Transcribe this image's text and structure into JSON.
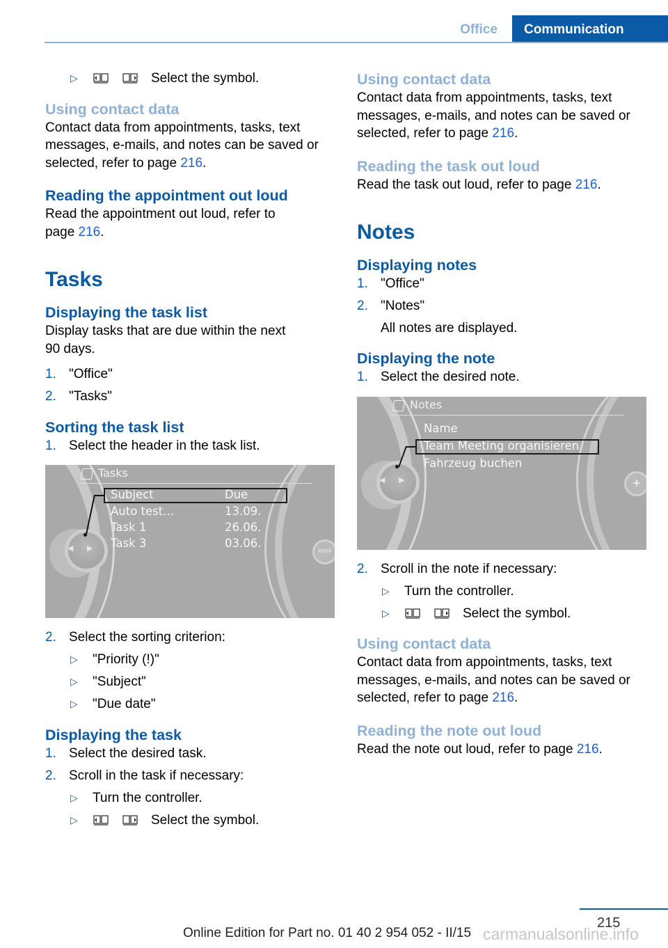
{
  "header": {
    "section_tab": "Office",
    "chapter_tab": "Communication"
  },
  "left": {
    "top_bullet": "Select the symbol.",
    "using_contact": {
      "heading": "Using contact data",
      "text": "Contact data from appointments, tasks, text messages, e-mails, and notes can be saved or selected, refer to page ",
      "page_ref": "216",
      "end": "."
    },
    "reading_appointment": {
      "heading": "Reading the appointment out loud",
      "text": "Read the appointment out loud, refer to page ",
      "page_ref": "216",
      "end": "."
    },
    "tasks_title": "Tasks",
    "displaying_task_list": {
      "heading": "Displaying the task list",
      "text": "Display tasks that are due within the next 90 days.",
      "steps": [
        {
          "num": "1.",
          "text": "\"Office\""
        },
        {
          "num": "2.",
          "text": "\"Tasks\""
        }
      ]
    },
    "sorting": {
      "heading": "Sorting the task list",
      "step1": {
        "num": "1.",
        "text": "Select the header in the task list."
      },
      "screen": {
        "title": "Tasks",
        "header_subject": "Subject",
        "header_due": "Due",
        "rows": [
          {
            "subject": "Auto test...",
            "due": "13.09."
          },
          {
            "subject": "Task 1",
            "due": "26.06."
          },
          {
            "subject": "Task 3",
            "due": "03.06."
          }
        ]
      },
      "step2": {
        "num": "2.",
        "text": "Select the sorting criterion:"
      },
      "options": [
        "\"Priority (!)\"",
        "\"Subject\"",
        "\"Due date\""
      ]
    },
    "displaying_task": {
      "heading": "Displaying the task",
      "steps": [
        {
          "num": "1.",
          "text": "Select the desired task."
        },
        {
          "num": "2.",
          "text": "Scroll in the task if necessary:"
        }
      ],
      "bullets": [
        "Turn the controller.",
        "Select the symbol."
      ]
    }
  },
  "right": {
    "using_contact": {
      "heading": "Using contact data",
      "text": "Contact data from appointments, tasks, text messages, e-mails, and notes can be saved or selected, refer to page ",
      "page_ref": "216",
      "end": "."
    },
    "reading_task": {
      "heading": "Reading the task out loud",
      "text": "Read the task out loud, refer to page ",
      "page_ref": "216",
      "end": "."
    },
    "notes_title": "Notes",
    "displaying_notes": {
      "heading": "Displaying notes",
      "steps": [
        {
          "num": "1.",
          "text": "\"Office\""
        },
        {
          "num": "2.",
          "text": "\"Notes\""
        }
      ],
      "result": "All notes are displayed."
    },
    "displaying_note": {
      "heading": "Displaying the note",
      "step1": {
        "num": "1.",
        "text": "Select the desired note."
      },
      "screen": {
        "title": "Notes",
        "rows": [
          "Name",
          "Team Meeting organisieren",
          "Fahrzeug buchen"
        ]
      },
      "step2": {
        "num": "2.",
        "text": "Scroll in the note if necessary:"
      },
      "bullets": [
        "Turn the controller.",
        "Select the symbol."
      ]
    },
    "using_contact2": {
      "heading": "Using contact data",
      "text": "Contact data from appointments, tasks, text messages, e-mails, and notes can be saved or selected, refer to page ",
      "page_ref": "216",
      "end": "."
    },
    "reading_note": {
      "heading": "Reading the note out loud",
      "text": "Read the note out loud, refer to page ",
      "page_ref": "216",
      "end": "."
    }
  },
  "footer": {
    "page_number": "215",
    "edition": "Online Edition for Part no. 01 40 2 954 052 - II/15",
    "watermark": "carmanualsonline.info"
  },
  "colors": {
    "accent": "#0a5aa5",
    "light_heading": "#8fb1d8",
    "link": "#1a62d8"
  }
}
